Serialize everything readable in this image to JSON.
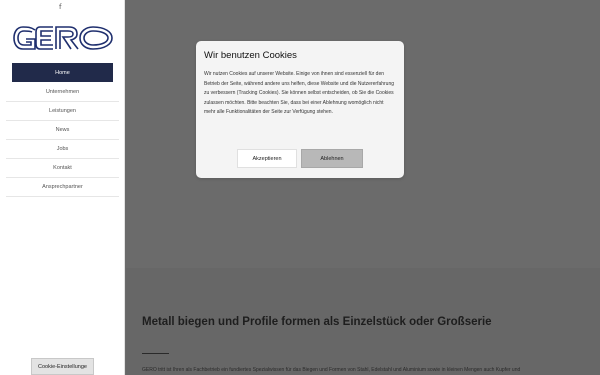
{
  "sidebar": {
    "social_icon": "f",
    "logo_text": "GERO",
    "nav": [
      {
        "label": "Home",
        "active": true
      },
      {
        "label": "Unternehmen"
      },
      {
        "label": "Leistungen"
      },
      {
        "label": "News"
      },
      {
        "label": "Jobs"
      },
      {
        "label": "Kontakt"
      },
      {
        "label": "Ansprechpartner"
      }
    ],
    "cookie_settings_label": "Cookie-Einstellunge"
  },
  "main": {
    "headline": "Metall biegen und Profile formen als Einzelstück oder Großserie",
    "body_text": "GERO tritt ist Ihren als Fachbetrieb ein fundiertes Spezialwissen für das Biegen und Formen von Stahl, Edelstahl und Aluminium sowie in kleinen Mengen auch Kupfer und"
  },
  "cookie_modal": {
    "title": "Wir benutzen Cookies",
    "text": "Wir nutzen Cookies auf unserer Website. Einige von ihnen sind essenziell für den Betrieb der Seite, während andere uns helfen, diese Website und die Nutzererfahrung zu verbessern (Tracking Cookies). Sie können selbst entscheiden, ob Sie die Cookies zulassen möchten. Bitte beachten Sie, dass bei einer Ablehnung womöglich nicht mehr alle Funktionalitäten der Seite zur Verfügung stehen.",
    "accept_label": "Akzeptieren",
    "reject_label": "Ablehnen"
  },
  "colors": {
    "nav_active_bg": "#212a4a",
    "logo_blue": "#1f2f6e",
    "overlay": "#6b6b6b"
  }
}
